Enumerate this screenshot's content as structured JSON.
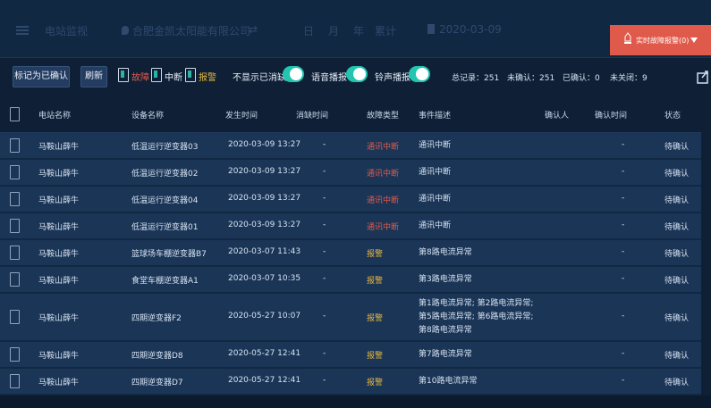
{
  "header": {
    "page_title": "电站监视",
    "company": "合肥金凯太阳能有限公司",
    "swap_icon": "swap-icon",
    "period_day": "日",
    "period_month": "月",
    "period_year": "年",
    "period_total": "累计",
    "date": "2020-03-09",
    "alarm_button_label": "实时故障报警(0)"
  },
  "toolbar": {
    "mark_confirmed": "标记为已确认",
    "refresh": "刷新",
    "legend_fault": "故障",
    "legend_interrupt": "中断",
    "legend_alarm": "报警",
    "hide_eliminated": "不显示已消缺",
    "voice_broadcast": "语音播报",
    "sound_broadcast": "铃声播报",
    "total_records": "总记录：251",
    "unconfirmed": "未确认：251",
    "confirmed": "已确认：0",
    "unclosed": "未关闭：9"
  },
  "table": {
    "headers": [
      "电站名称",
      "设备名称",
      "发生时间",
      "消缺时间",
      "故障类型",
      "事件描述",
      "确认人",
      "确认时间",
      "状态"
    ],
    "rows": [
      {
        "station": "马鞍山薛牛",
        "device": "低温运行逆变器03",
        "time": "2020-03-09 13:27",
        "eliminate": "-",
        "type": "通讯中断",
        "type_color": "red",
        "desc": [
          "通讯中断"
        ],
        "confirmer": "",
        "confirm_time": "-",
        "status": "待确认"
      },
      {
        "station": "马鞍山薛牛",
        "device": "低温运行逆变器02",
        "time": "2020-03-09 13:27",
        "eliminate": "-",
        "type": "通讯中断",
        "type_color": "red",
        "desc": [
          "通讯中断"
        ],
        "confirmer": "",
        "confirm_time": "-",
        "status": "待确认"
      },
      {
        "station": "马鞍山薛牛",
        "device": "低温运行逆变器04",
        "time": "2020-03-09 13:27",
        "eliminate": "-",
        "type": "通讯中断",
        "type_color": "red",
        "desc": [
          "通讯中断"
        ],
        "confirmer": "",
        "confirm_time": "-",
        "status": "待确认"
      },
      {
        "station": "马鞍山薛牛",
        "device": "低温运行逆变器01",
        "time": "2020-03-09 13:27",
        "eliminate": "-",
        "type": "通讯中断",
        "type_color": "red",
        "desc": [
          "通讯中断"
        ],
        "confirmer": "",
        "confirm_time": "-",
        "status": "待确认"
      },
      {
        "station": "马鞍山薛牛",
        "device": "篮球场车棚逆变器B7",
        "time": "2020-03-07 11:43",
        "eliminate": "-",
        "type": "报警",
        "type_color": "yellow",
        "desc": [
          "第8路电流异常"
        ],
        "confirmer": "",
        "confirm_time": "-",
        "status": "待确认"
      },
      {
        "station": "马鞍山薛牛",
        "device": "食堂车棚逆变器A1",
        "time": "2020-03-07 10:35",
        "eliminate": "-",
        "type": "报警",
        "type_color": "yellow",
        "desc": [
          "第3路电流异常"
        ],
        "confirmer": "",
        "confirm_time": "-",
        "status": "待确认"
      },
      {
        "station": "马鞍山薛牛",
        "device": "四期逆变器F2",
        "time": "2020-05-27 10:07",
        "eliminate": "-",
        "type": "报警",
        "type_color": "yellow",
        "desc": [
          "第1路电流异常; 第2路电流异常;",
          "第5路电流异常; 第6路电流异常;",
          "第8路电流异常"
        ],
        "confirmer": "",
        "confirm_time": "-",
        "status": "待确认"
      },
      {
        "station": "马鞍山薛牛",
        "device": "四期逆变器D8",
        "time": "2020-05-27 12:41",
        "eliminate": "-",
        "type": "报警",
        "type_color": "yellow",
        "desc": [
          "第7路电流异常"
        ],
        "confirmer": "",
        "confirm_time": "-",
        "status": "待确认"
      },
      {
        "station": "马鞍山薛牛",
        "device": "四期逆变器D7",
        "time": "2020-05-27 12:41",
        "eliminate": "-",
        "type": "报警",
        "type_color": "yellow",
        "desc": [
          "第10路电流异常"
        ],
        "confirmer": "",
        "confirm_time": "-",
        "status": "待确认"
      }
    ]
  }
}
